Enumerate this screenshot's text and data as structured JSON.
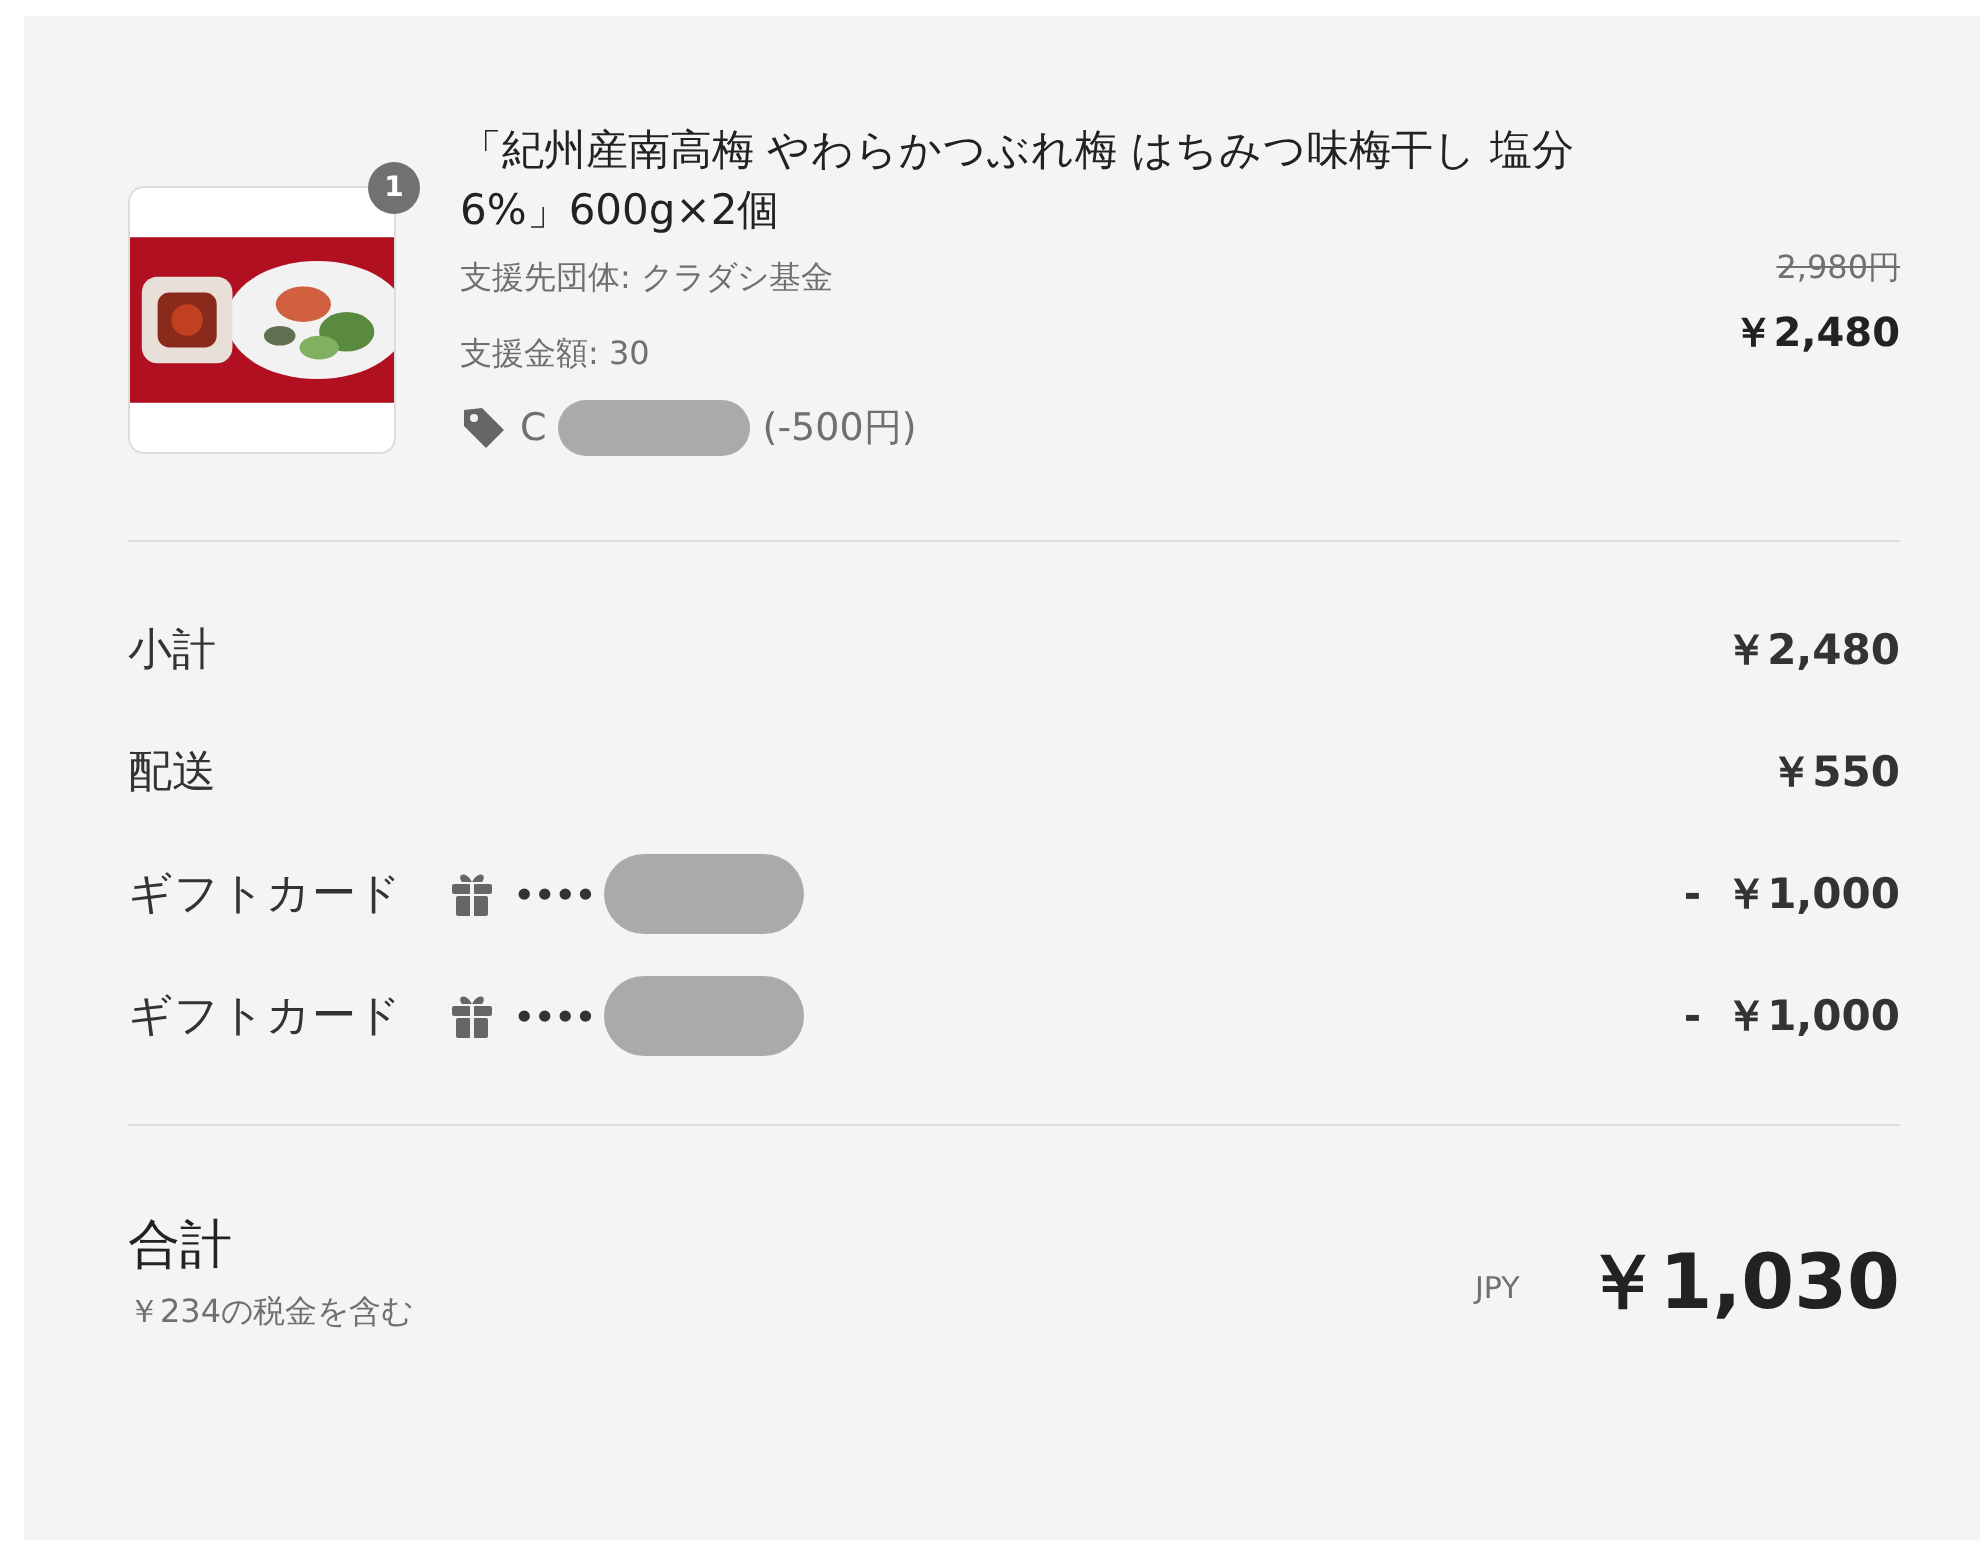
{
  "product": {
    "quantity": "1",
    "title": "「紀州産南高梅 やわらかつぶれ梅 はちみつ味梅干し 塩分6%」600g×2個",
    "details": [
      "支援先団体: クラダシ基金",
      "支援金額: 30"
    ],
    "discount": {
      "code": "C",
      "redacted": true,
      "amount": "(-500円)"
    },
    "original_price": "2,980円",
    "price": "￥2,480"
  },
  "lines": [
    {
      "kind": "plain",
      "label": "小計",
      "value": "￥2,480"
    },
    {
      "kind": "plain",
      "label": "配送",
      "value": "￥550"
    },
    {
      "kind": "gift",
      "label": "ギフトカード",
      "masked": "••••",
      "redacted": true,
      "sign": "-",
      "value": "￥1,000"
    },
    {
      "kind": "gift",
      "label": "ギフトカード",
      "masked": "••••",
      "redacted": true,
      "sign": "-",
      "value": "￥1,000"
    }
  ],
  "total": {
    "label": "合計",
    "tax_note": "￥234の税金を含む",
    "currency": "JPY",
    "amount": "￥1,030"
  }
}
